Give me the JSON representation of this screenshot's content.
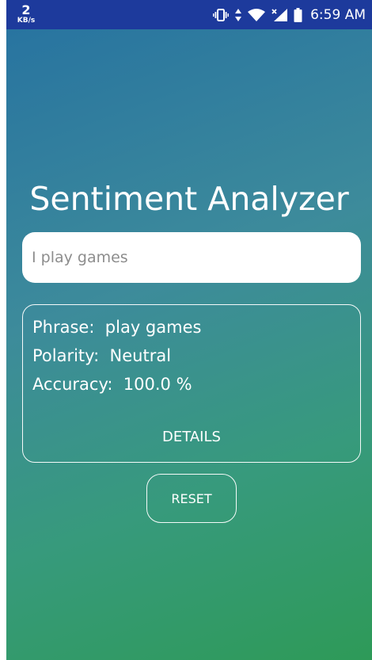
{
  "status_bar": {
    "net_speed_value": "2",
    "net_speed_unit": "KB/s",
    "time": "6:59 AM",
    "icons": [
      "vibrate-icon",
      "data-transfer-icon",
      "wifi-icon",
      "signal-icon",
      "battery-icon"
    ],
    "background_color": "#1d3a9c"
  },
  "app": {
    "title": "Sentiment Analyzer",
    "input": {
      "value": "",
      "placeholder": "I play games"
    },
    "result": {
      "phrase_label": "Phrase:",
      "phrase_value": "play games",
      "polarity_label": "Polarity:",
      "polarity_value": "Neutral",
      "accuracy_label": "Accuracy:",
      "accuracy_value": "100.0 %",
      "details_label": "DETAILS"
    },
    "reset_label": "RESET",
    "gradient_colors": [
      "#2874a0",
      "#3d8b9b",
      "#379a7c",
      "#2e9a58"
    ]
  }
}
